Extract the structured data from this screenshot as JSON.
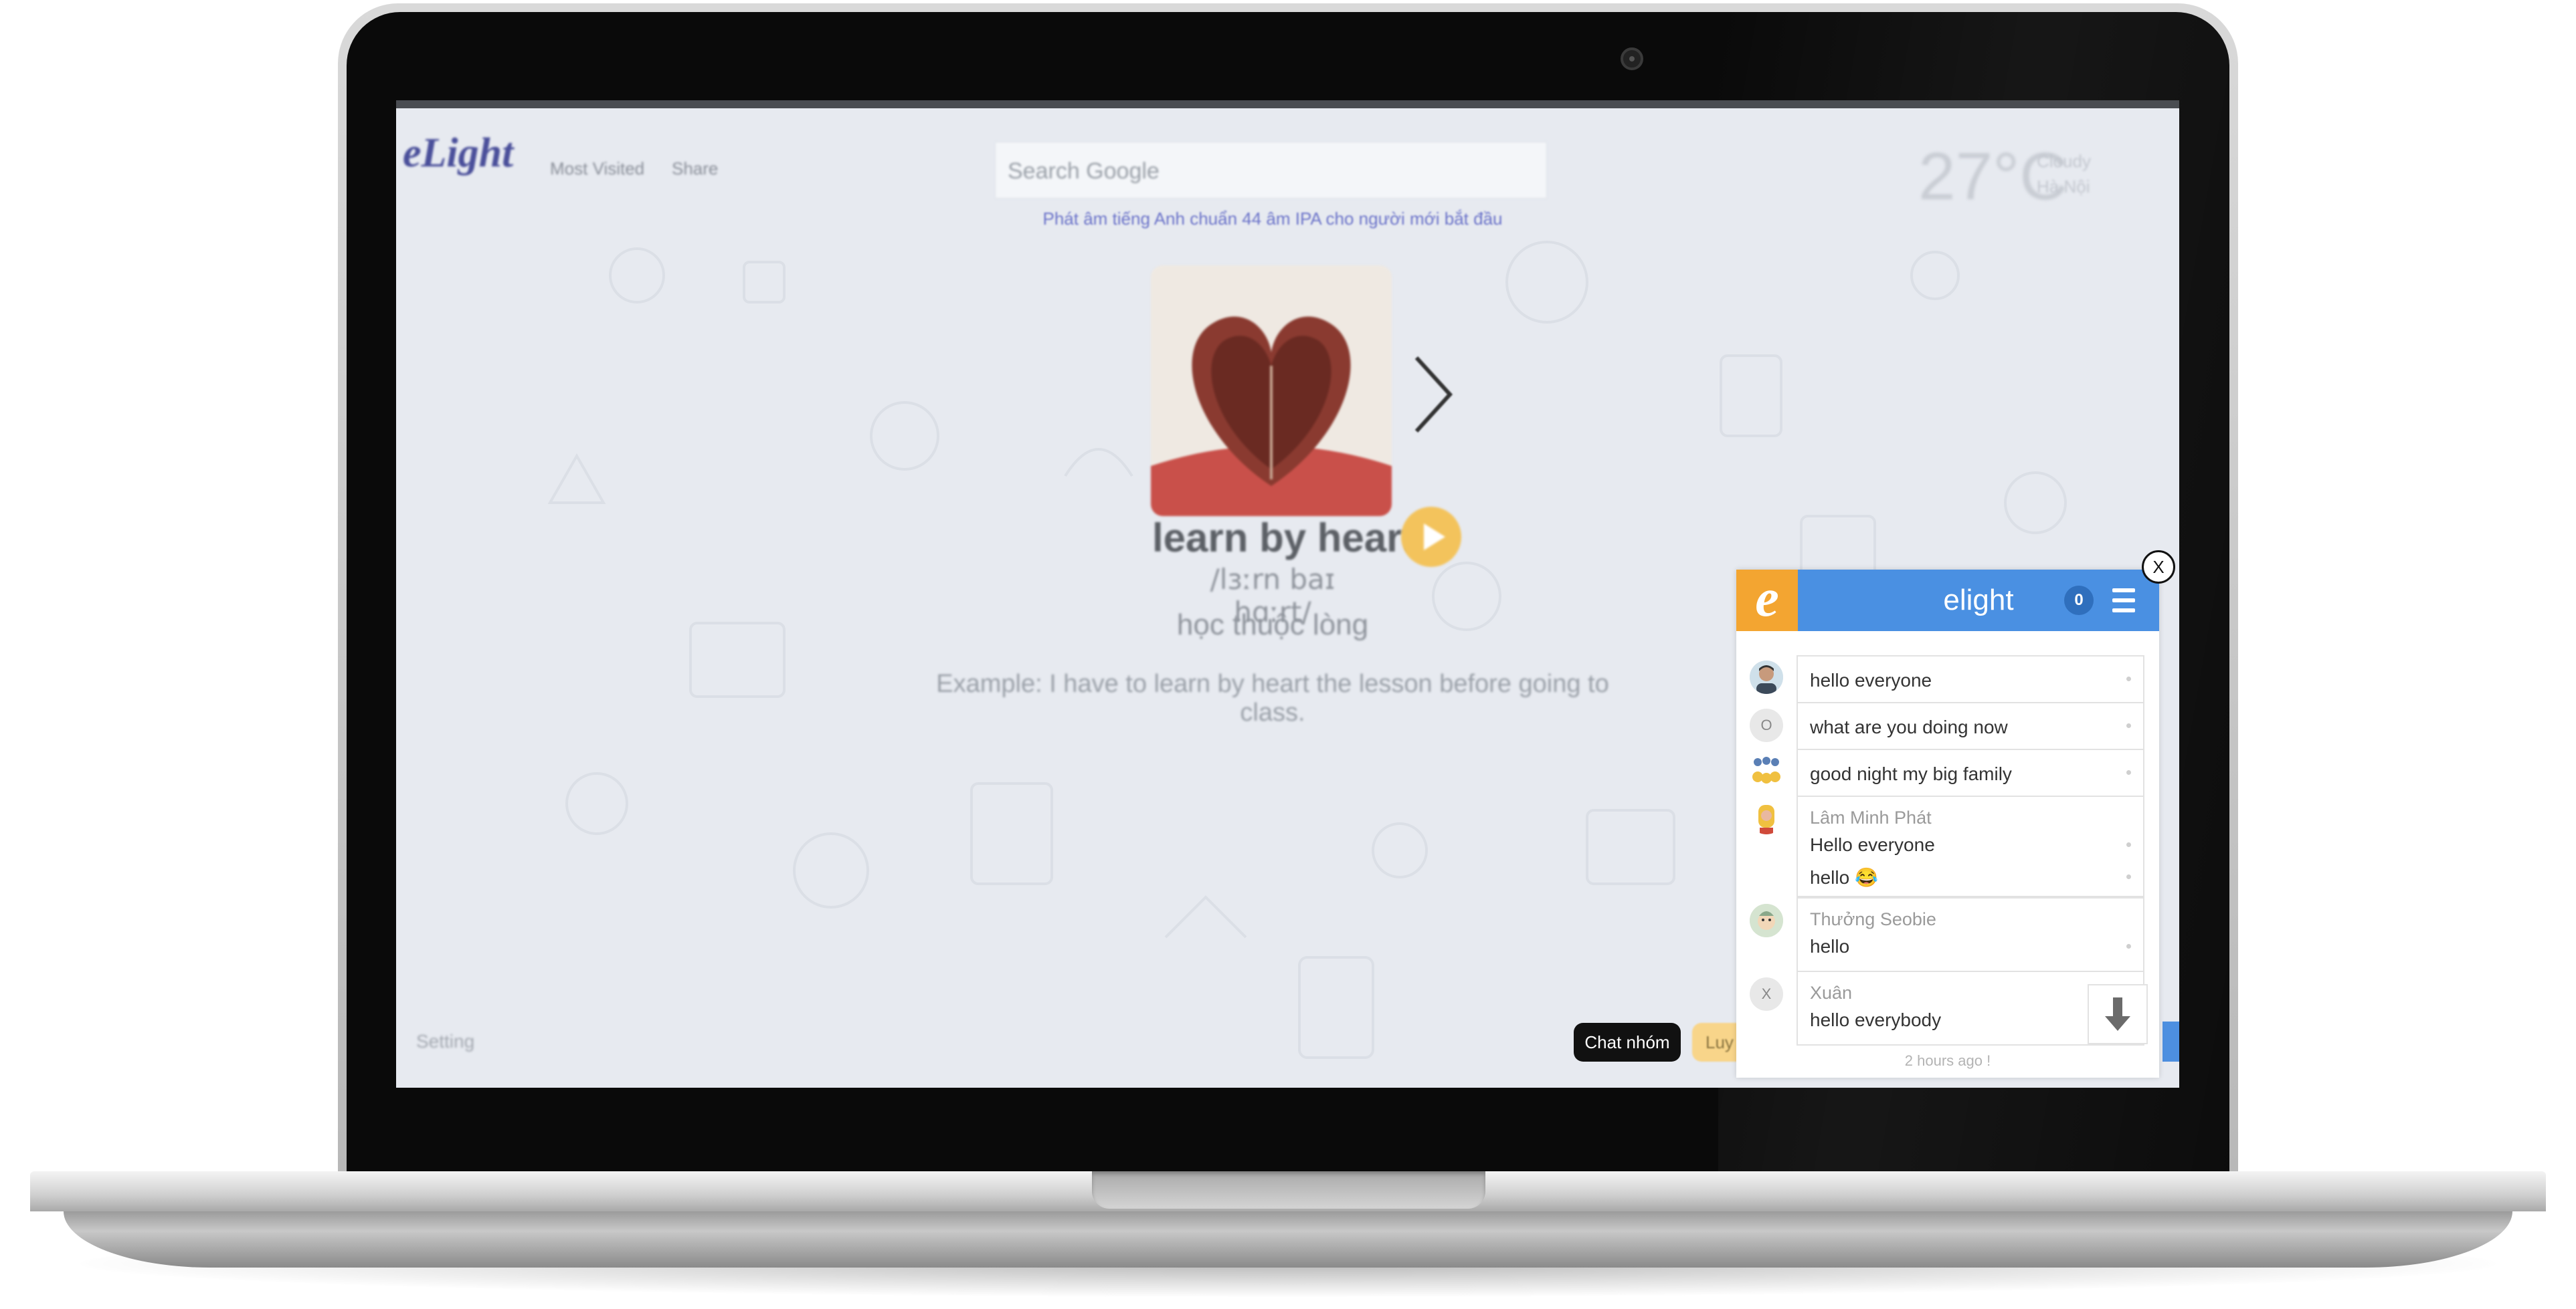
{
  "page": {
    "logo": "eLight",
    "nav": [
      "Most Visited",
      "Share"
    ],
    "search_placeholder": "Search Google",
    "tagline": "Phát âm tiếng Anh chuẩn 44 âm IPA cho người mới bắt đầu",
    "weather": {
      "temperature": "27°C",
      "condition": "Cloudy",
      "location": "Hà Nội"
    },
    "flashcard": {
      "word": "learn by heart",
      "ipa": "/lɜːrn baɪ hɑːrt/",
      "meaning": "học thuộc lòng",
      "example": "Example: I have to learn by heart the lesson before going to class."
    },
    "footer": {
      "setting": "Setting",
      "chat_button": "Chat nhóm",
      "practice_button": "Luy"
    }
  },
  "chat": {
    "logo_letter": "e",
    "title": "elight",
    "badge_count": "0",
    "close_label": "X",
    "messages": [
      {
        "avatar": "",
        "name": "",
        "lines": [
          "hello everyone"
        ]
      },
      {
        "avatar": "O",
        "name": "",
        "lines": [
          "what are you doing now"
        ]
      },
      {
        "avatar": "",
        "name": "",
        "lines": [
          "good night my big family"
        ]
      },
      {
        "avatar": "",
        "name": "Lâm Minh Phát",
        "lines": [
          "Hello everyone",
          "hello 😂"
        ]
      },
      {
        "avatar": "",
        "name": "Thưởng Seobie",
        "lines": [
          "hello"
        ]
      },
      {
        "avatar": "X",
        "name": "Xuân",
        "lines": [
          "hello everybody"
        ]
      }
    ],
    "timestamp": "2 hours ago !"
  },
  "colors": {
    "chat_header": "#4a90e2",
    "chat_logo": "#f3a531",
    "tagline": "#6b73c9",
    "page_bg": "#e7eaf0"
  },
  "icons": [
    "webcam-icon",
    "next-arrow-icon",
    "play-audio-icon",
    "menu-icon",
    "close-icon",
    "scroll-down-icon"
  ]
}
